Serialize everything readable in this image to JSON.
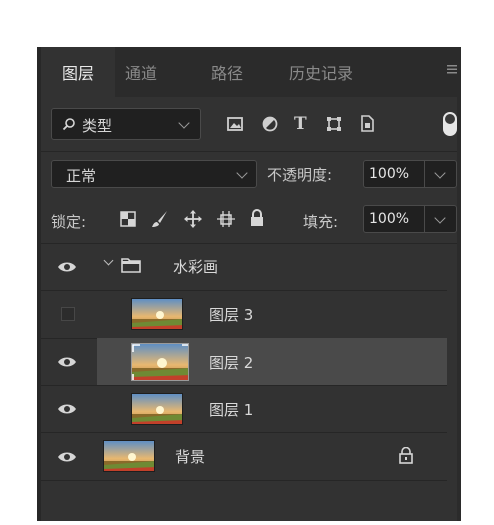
{
  "tabs": [
    {
      "label": "图层",
      "active": true
    },
    {
      "label": "通道",
      "active": false
    },
    {
      "label": "路径",
      "active": false
    },
    {
      "label": "历史记录",
      "active": false
    }
  ],
  "panel_menu_icon": "hamburger-icon",
  "filter": {
    "search_icon": "search-icon",
    "kind_label": "类型",
    "filter_icons": [
      "image-filter-icon",
      "adjustment-filter-icon",
      "type-filter-icon",
      "shape-filter-icon",
      "smart-object-filter-icon",
      "filter-toggle-icon"
    ],
    "type_icon_text": "T"
  },
  "blend": {
    "mode": "正常",
    "opacity_label": "不透明度:",
    "opacity_value": "100%"
  },
  "lock": {
    "label": "锁定:",
    "icons": [
      "lock-transparent-pixels-icon",
      "lock-image-pixels-icon",
      "lock-position-icon",
      "prevent-auto-nesting-icon",
      "lock-all-icon"
    ],
    "fill_label": "填充:",
    "fill_value": "100%"
  },
  "layers": [
    {
      "name": "水彩画",
      "type": "group",
      "visible": true,
      "expanded": true,
      "selected": false
    },
    {
      "name": "图层 3",
      "type": "layer",
      "visible": false,
      "selected": false
    },
    {
      "name": "图层 2",
      "type": "layer",
      "visible": true,
      "selected": true
    },
    {
      "name": "图层 1",
      "type": "layer",
      "visible": true,
      "selected": false
    },
    {
      "name": "背景",
      "type": "background",
      "visible": true,
      "locked": true,
      "selected": false
    }
  ],
  "colors": {
    "panel_bg": "#323232",
    "tab_bar_bg": "#2b2b2b",
    "selected_row": "#4a4a4a",
    "text": "#d6d6d6"
  }
}
